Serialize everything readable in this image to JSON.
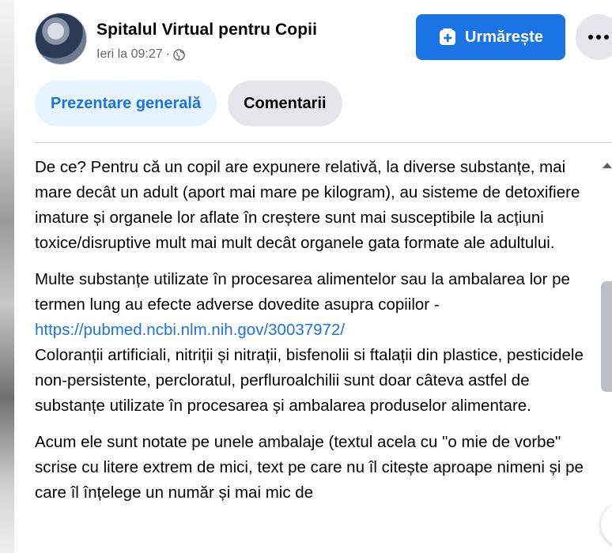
{
  "post": {
    "page_name": "Spitalul Virtual pentru Copii",
    "timestamp": "Ieri la 09:27",
    "separator": "·",
    "privacy_icon": "globe-icon"
  },
  "actions": {
    "follow_label": "Urmărește",
    "follow_icon": "follow-add-icon",
    "more_icon": "more-dots-icon",
    "accent": "#1b74e4"
  },
  "tabs": [
    {
      "label": "Prezentare generală",
      "active": true
    },
    {
      "label": "Comentarii",
      "active": false
    }
  ],
  "body": {
    "p1": "De ce? Pentru că un copil are expunere relativă, la diverse substanțe, mai mare decât un adult (aport mai mare pe kilogram), au sisteme de detoxifiere imature și organele lor aflate în creștere sunt mai susceptibile la acțiuni toxice/disruptive mult mai mult decât organele gata formate ale adultului.",
    "p2_text": "Multe substanțe utilizate în procesarea alimentelor sau la ambalarea lor pe termen lung au efecte adverse dovedite asupra copiilor - ",
    "p2_link": "https://pubmed.ncbi.nlm.nih.gov/30037972/",
    "p2_after": "Coloranții artificiali, nitriții și nitrații, bisfenolii si ftalații din plastice, pesticidele non-persistente, percloratul, perfluroalchilii sunt doar câteva astfel de substanțe utilizate în procesarea și ambalarea produselor alimentare.",
    "p3": "Acum ele sunt notate pe unele ambalaje (textul acela cu \"o mie de vorbe\" scrise cu litere extrem de mici, text pe care nu îl citește aproape nimeni și pe care îl înțelege un număr și mai mic de"
  }
}
